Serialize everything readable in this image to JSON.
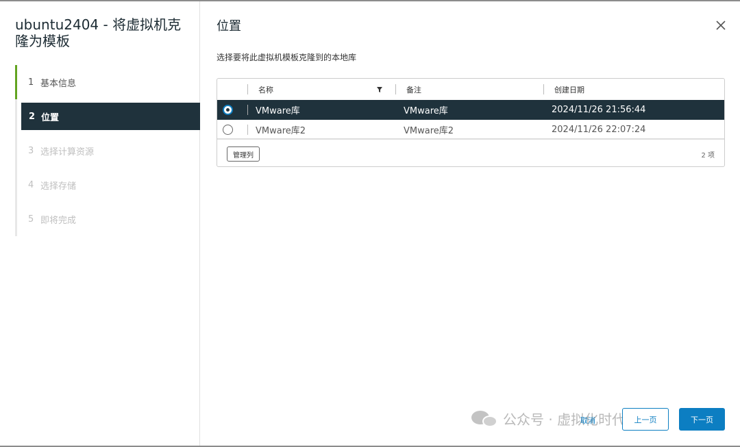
{
  "wizard": {
    "title": "ubuntu2404 - 将虚拟机克隆为模板",
    "steps": [
      {
        "num": "1",
        "label": "基本信息"
      },
      {
        "num": "2",
        "label": "位置"
      },
      {
        "num": "3",
        "label": "选择计算资源"
      },
      {
        "num": "4",
        "label": "选择存储"
      },
      {
        "num": "5",
        "label": "即将完成"
      }
    ]
  },
  "main": {
    "title": "位置",
    "subtitle": "选择要将此虚拟机模板克隆到的本地库",
    "columns": {
      "name": "名称",
      "notes": "备注",
      "created": "创建日期"
    },
    "rows": [
      {
        "name": "VMware库",
        "notes": "VMware库",
        "created": "2024/11/26 21:56:44",
        "selected": true
      },
      {
        "name": "VMware库2",
        "notes": "VMware库2",
        "created": "2024/11/26 22:07:24",
        "selected": false
      }
    ],
    "manage_columns": "管理列",
    "count": "2 项"
  },
  "footer": {
    "cancel": "取消",
    "prev": "上一页",
    "next": "下一页",
    "watermark": "公众号 · 虚拟化时代君"
  },
  "colors": {
    "accent": "#0c7ec2",
    "selected_row": "#1f323c",
    "done_marker": "#62a420"
  },
  "icons": {
    "close": "close-icon",
    "filter": "filter-icon",
    "wechat": "wechat-logo-icon"
  }
}
